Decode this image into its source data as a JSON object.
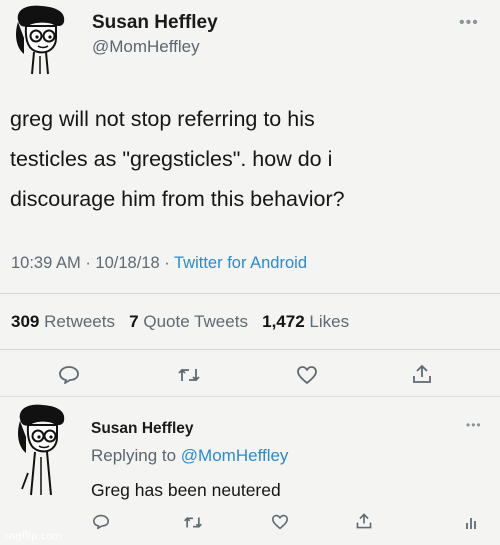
{
  "tweet": {
    "author_name": "Susan Heffley",
    "handle": "@MomHeffley",
    "text_line1": "greg will not stop referring to his",
    "text_line2": "testicles as \"gregsticles\". how do i",
    "text_line3": "discourage him from this behavior?",
    "time": "10:39 AM",
    "date": "10/18/18",
    "source": "Twitter for Android",
    "retweets_count": "309",
    "retweets_label": "Retweets",
    "quote_count": "7",
    "quote_label": "Quote Tweets",
    "likes_count": "1,472",
    "likes_label": "Likes",
    "more_icon": "more-icon",
    "actions": [
      "reply-icon",
      "retweet-icon",
      "like-icon",
      "share-icon"
    ]
  },
  "reply": {
    "author_name": "Susan Heffley",
    "replying_label": "Replying to",
    "replying_handle": "@MomHeffley",
    "text": "Greg has been neutered",
    "more_icon": "more-icon",
    "actions": [
      "reply-icon",
      "retweet-icon",
      "like-icon",
      "share-icon",
      "analytics-icon"
    ]
  },
  "watermark": "imgflip.com",
  "colors": {
    "link": "#2a8bd1",
    "secondary": "#5f6a72",
    "background": "#f4f4f2"
  }
}
